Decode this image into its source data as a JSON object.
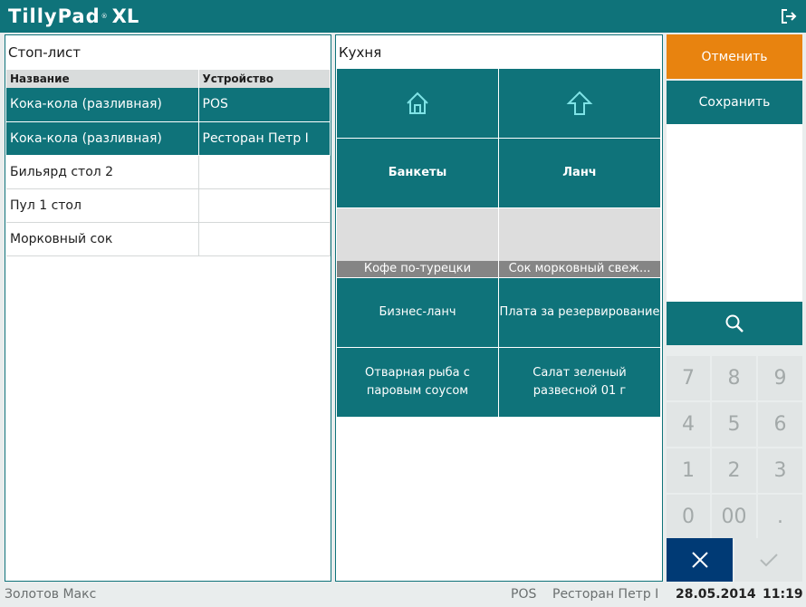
{
  "app": {
    "logo": "TillyPad",
    "logo_suffix": "XL",
    "logo_mark": "®"
  },
  "stop_list": {
    "title": "Стоп-лист",
    "columns": [
      "Название",
      "Устройство"
    ],
    "rows": [
      {
        "name": "Кока-кола (разливная)",
        "device": "POS",
        "selected": true
      },
      {
        "name": "Кока-кола (разливная)",
        "device": "Ресторан Петр I",
        "selected": true
      },
      {
        "name": "Бильярд стол 2",
        "device": "",
        "selected": false
      },
      {
        "name": "Пул 1 стол",
        "device": "",
        "selected": false
      },
      {
        "name": "Морковный сок",
        "device": "",
        "selected": false
      }
    ]
  },
  "kitchen": {
    "title": "Кухня",
    "tiles": [
      {
        "type": "icon",
        "icon": "home-icon"
      },
      {
        "type": "icon",
        "icon": "up-arrow-icon"
      },
      {
        "type": "text",
        "label": "Банкеты",
        "bold": true
      },
      {
        "type": "text",
        "label": "Ланч",
        "bold": true
      },
      {
        "type": "image",
        "label": "Кофе по-турецки",
        "image": "coffee"
      },
      {
        "type": "image",
        "label": "Сок морковный свеж...",
        "image": "juice"
      },
      {
        "type": "text",
        "label": "Бизнес-ланч"
      },
      {
        "type": "text",
        "label": "Плата за резервирование"
      },
      {
        "type": "text",
        "label": "Отварная рыба с паровым соусом"
      },
      {
        "type": "text",
        "label": "Салат зеленый развесной 01 г"
      }
    ]
  },
  "actions": {
    "cancel": "Отменить",
    "save": "Сохранить"
  },
  "keypad": {
    "keys": [
      "7",
      "8",
      "9",
      "4",
      "5",
      "6",
      "1",
      "2",
      "3",
      "0",
      "00",
      "."
    ]
  },
  "status": {
    "user": "Золотов Макс",
    "device": "POS",
    "restaurant": "Ресторан Петр I",
    "date": "28.05.2014",
    "time": "11:19"
  },
  "colors": {
    "primary": "#0f737a",
    "accent": "#e8830f",
    "dark": "#003a75"
  }
}
